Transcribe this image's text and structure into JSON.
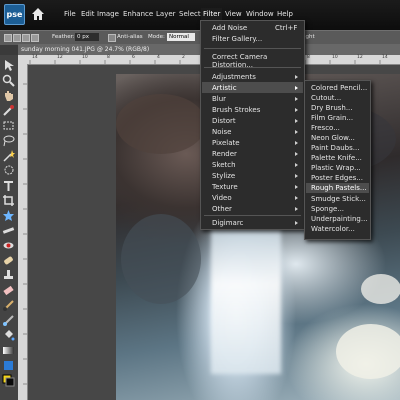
{
  "app": {
    "logo_text": "pse",
    "menu": [
      "File",
      "Edit",
      "Image",
      "Enhance",
      "Layer",
      "Select",
      "Filter",
      "View",
      "Window",
      "Help"
    ],
    "active_menu": "Filter"
  },
  "options_bar": {
    "feather_label": "Feather:",
    "feather_value": "0 px",
    "anti_alias_label": "Anti-alias",
    "mode_label": "Mode:",
    "mode_value": "Normal",
    "height_label": "ight"
  },
  "document": {
    "tab_title": "sunday morning 041.JPG @ 24.7% (RGB/8)"
  },
  "ruler_marks": [
    "14",
    "12",
    "10",
    "8",
    "6",
    "4",
    "2",
    "0",
    "2",
    "4",
    "6",
    "8",
    "10",
    "12",
    "14"
  ],
  "filter_menu": {
    "top_items": [
      {
        "label": "Add Noise",
        "shortcut": "Ctrl+F"
      },
      {
        "label": "Filter Gallery...",
        "shortcut": ""
      },
      {
        "label": "Correct Camera Distortion...",
        "shortcut": ""
      }
    ],
    "categories": [
      "Adjustments",
      "Artistic",
      "Blur",
      "Brush Strokes",
      "Distort",
      "Noise",
      "Pixelate",
      "Render",
      "Sketch",
      "Stylize",
      "Texture",
      "Video",
      "Other"
    ],
    "highlighted_category": "Artistic",
    "extra": [
      "Digimarc"
    ]
  },
  "artistic_submenu": {
    "items": [
      "Colored Pencil...",
      "Cutout...",
      "Dry Brush...",
      "Film Grain...",
      "Fresco...",
      "Neon Glow...",
      "Paint Daubs...",
      "Palette Knife...",
      "Plastic Wrap...",
      "Poster Edges...",
      "Rough Pastels...",
      "Smudge Stick...",
      "Sponge...",
      "Underpainting...",
      "Watercolor..."
    ],
    "highlighted": "Rough Pastels..."
  },
  "colors": {
    "menu_bg": "#2b2b2b",
    "highlight": "#4d4d4d",
    "menubar": "#111111"
  }
}
